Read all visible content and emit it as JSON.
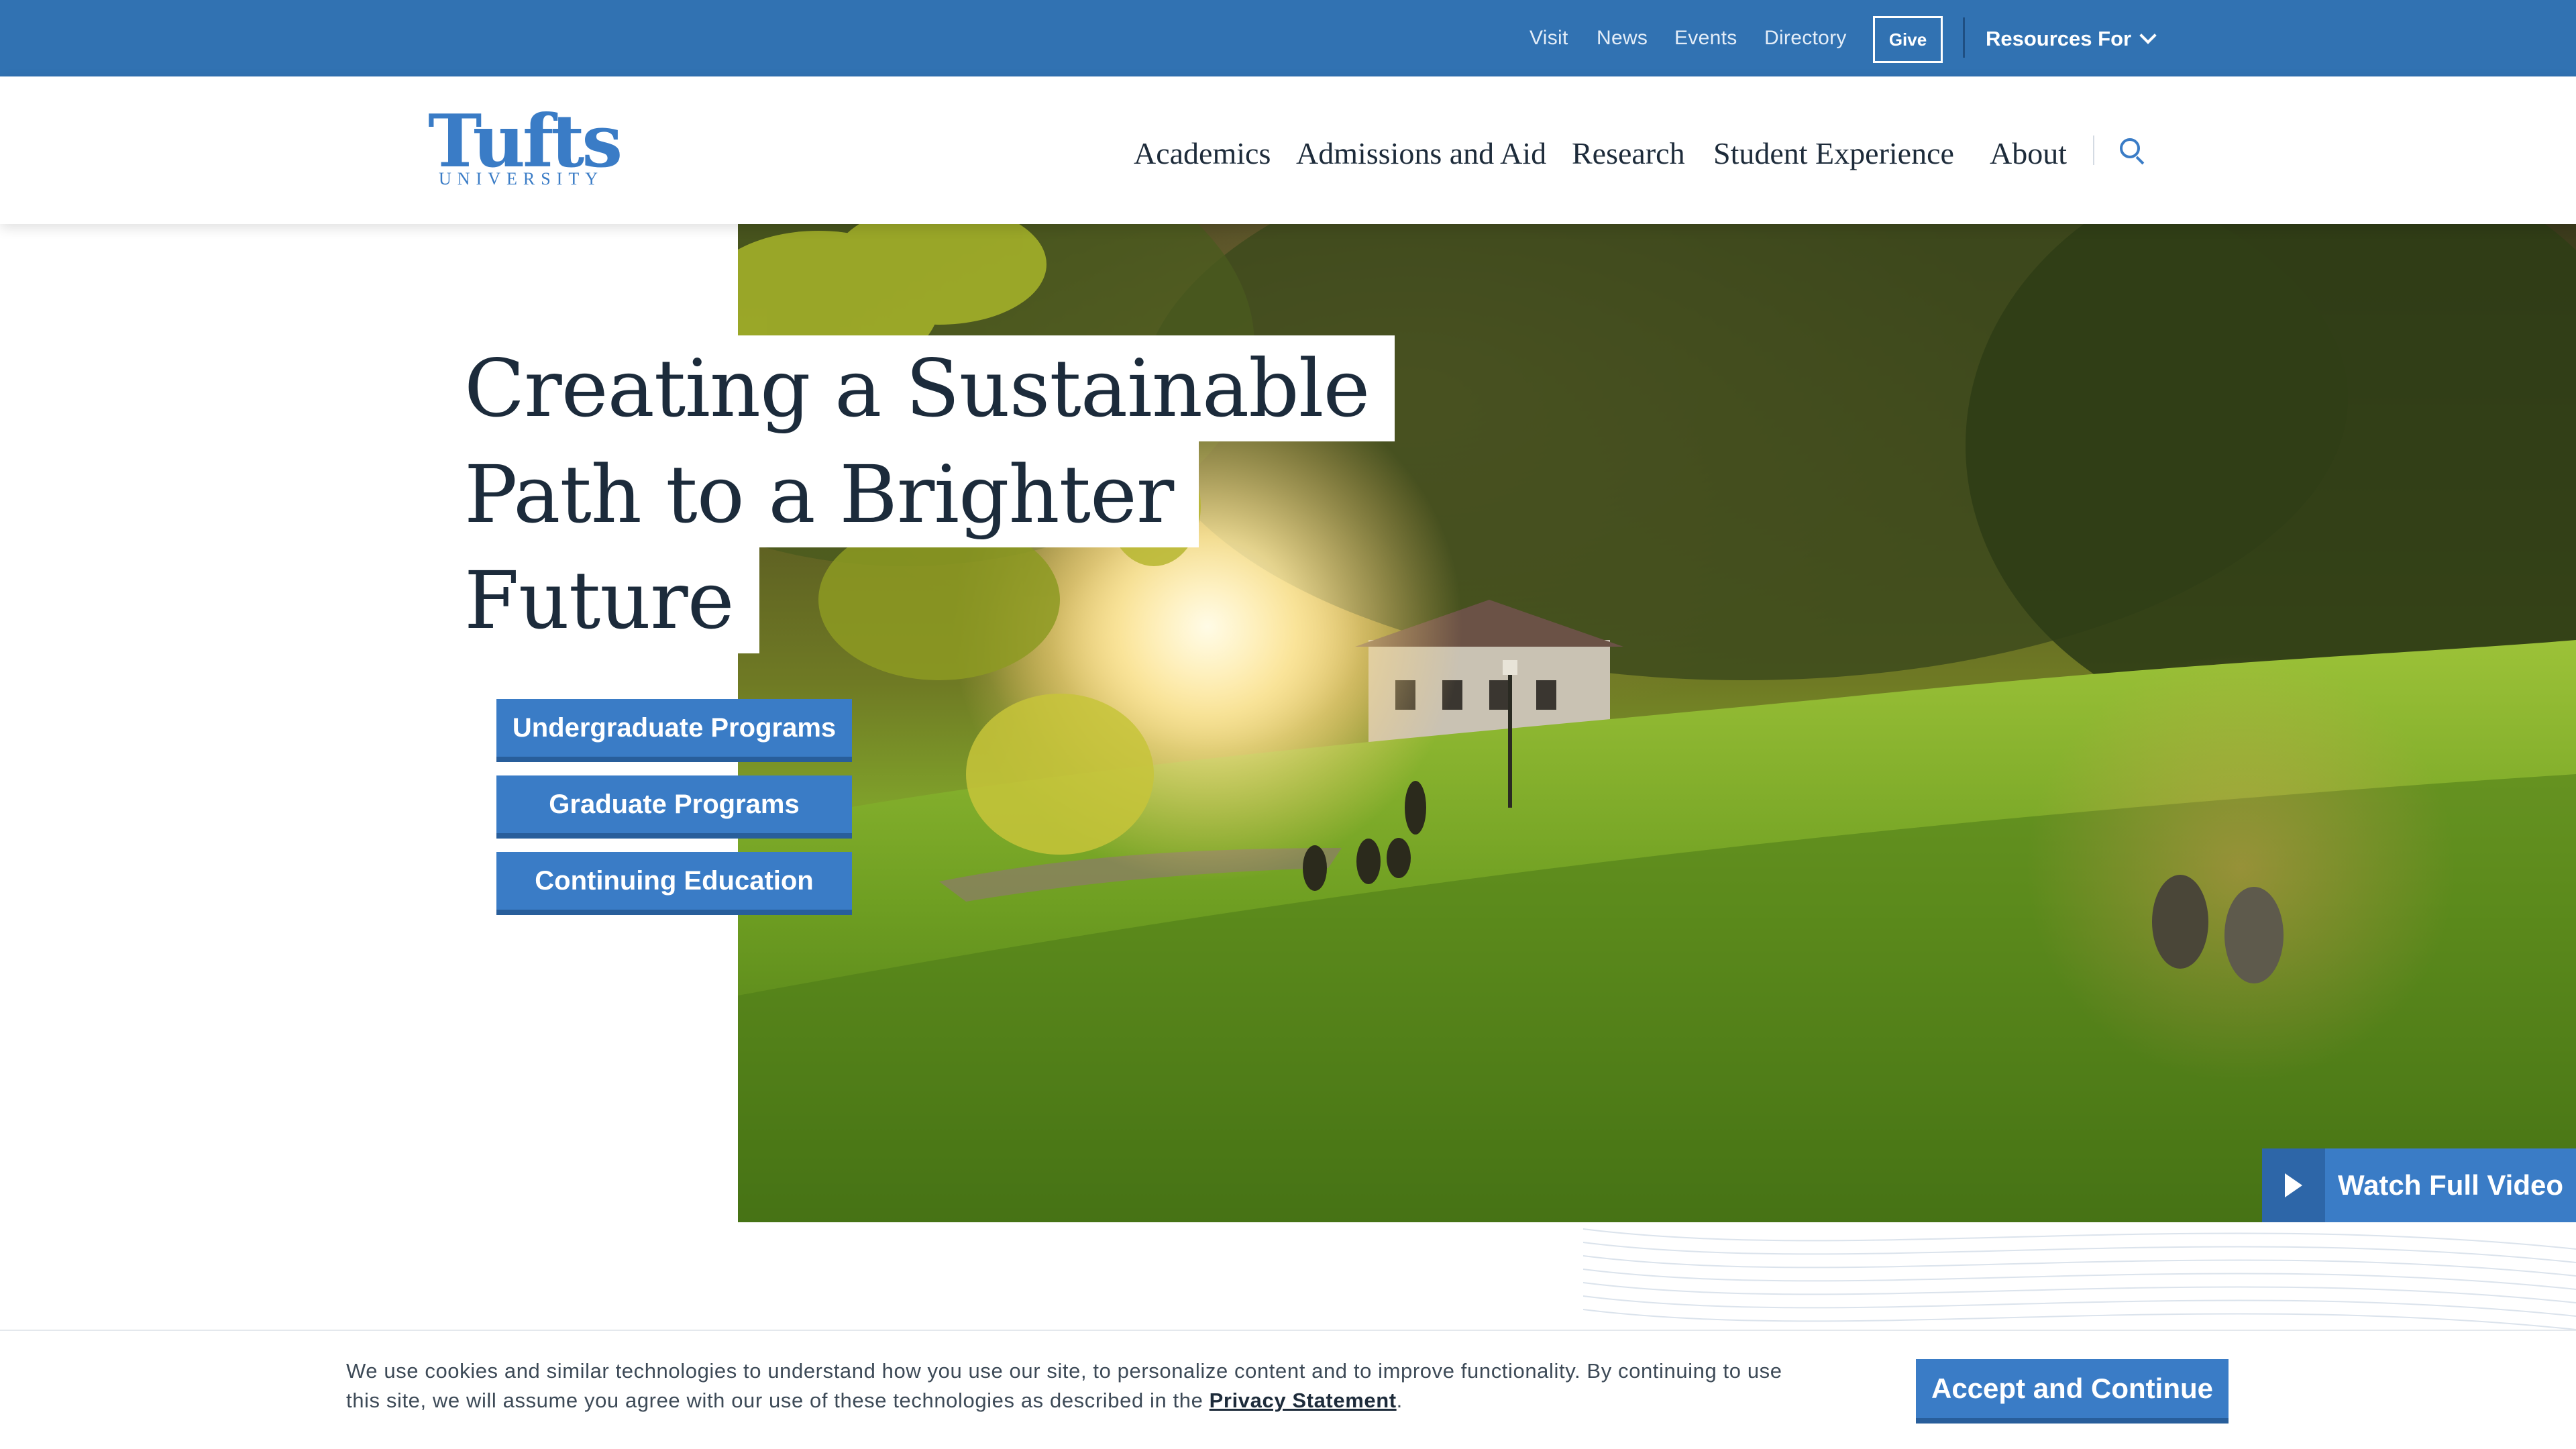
{
  "utility_nav": {
    "links": [
      "Visit",
      "News",
      "Events",
      "Directory"
    ],
    "give_label": "Give",
    "resources_label": "Resources For",
    "bg_color": "#3172b2"
  },
  "brand": {
    "logo_word": "Tufts",
    "logo_sub": "UNIVERSITY",
    "color": "#3a7cc6"
  },
  "main_nav": {
    "items": [
      "Academics",
      "Admissions and Aid",
      "Research",
      "Student Experience",
      "About"
    ],
    "search_icon": "search-icon"
  },
  "hero": {
    "headline_lines": [
      "Creating a Sustainable",
      "Path to a Brighter",
      "Future"
    ],
    "buttons": [
      "Undergraduate Programs",
      "Graduate Programs",
      "Continuing Education"
    ],
    "watch_label": "Watch Full Video",
    "watch_icon": "play-icon"
  },
  "cookie": {
    "text": "We use cookies and similar technologies to understand how you use our site, to personalize content and to improve functionality. By continuing to use this site, we will assume you agree with our use of these technologies as described in the ",
    "link_label": "Privacy Statement",
    "suffix": ".",
    "accept_label": "Accept and Continue"
  }
}
